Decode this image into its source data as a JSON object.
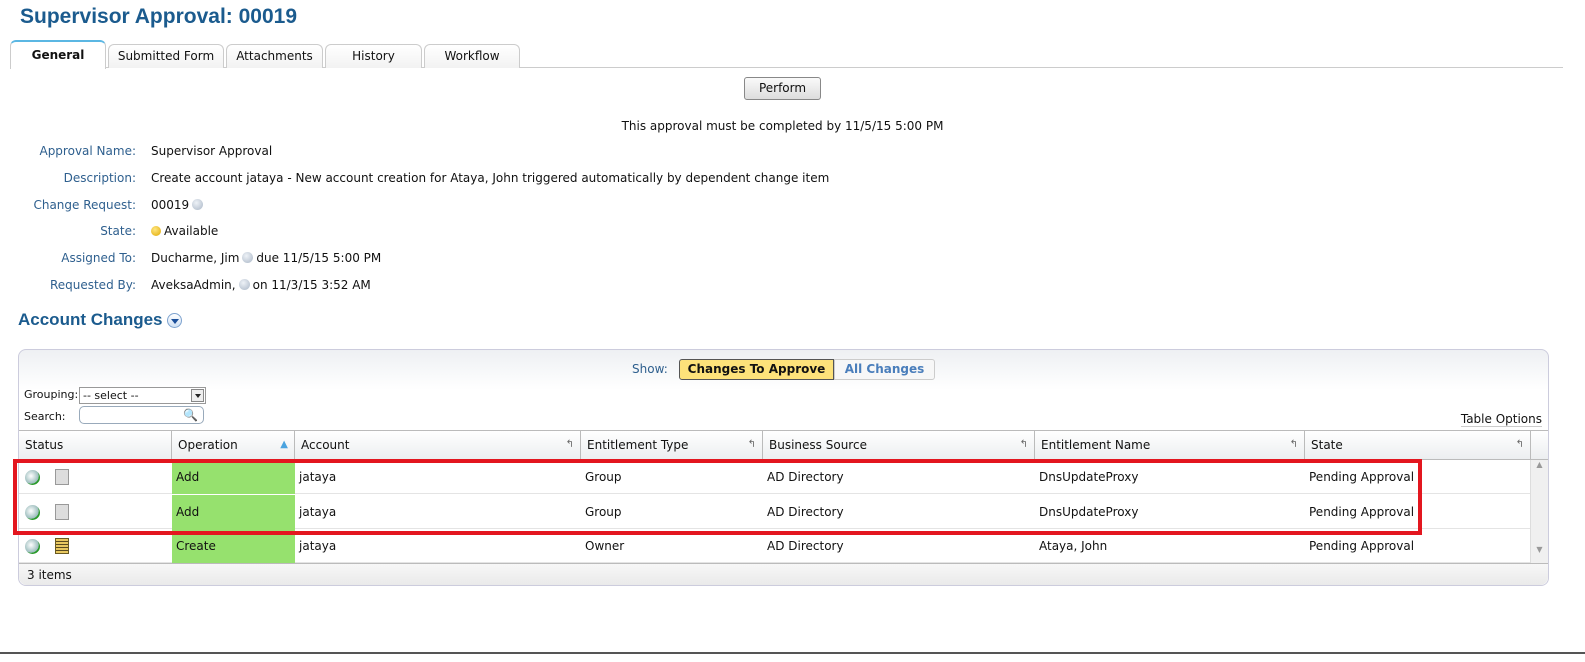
{
  "title": "Supervisor Approval: 00019",
  "tabs": [
    {
      "label": "General",
      "active": true
    },
    {
      "label": "Submitted Form"
    },
    {
      "label": "Attachments"
    },
    {
      "label": "History"
    },
    {
      "label": "Workflow"
    }
  ],
  "perform_label": "Perform",
  "notice": "This approval must be completed by 11/5/15 5:00 PM",
  "fields": {
    "approval_name": {
      "label": "Approval Name:",
      "value": "Supervisor Approval"
    },
    "description": {
      "label": "Description:",
      "value": "Create account jataya - New account creation for Ataya, John triggered automatically by dependent change item"
    },
    "change_request": {
      "label": "Change Request:",
      "value": "00019"
    },
    "state": {
      "label": "State:",
      "value": "Available"
    },
    "assigned_to": {
      "label": "Assigned To:",
      "value": "Ducharme, Jim",
      "suffix": "due 11/5/15 5:00 PM"
    },
    "requested_by": {
      "label": "Requested By:",
      "value": "AveksaAdmin,",
      "suffix": "on 11/3/15 3:52 AM"
    }
  },
  "section_title": "Account Changes",
  "show": {
    "label": "Show:",
    "options": [
      "Changes To Approve",
      "All Changes"
    ],
    "selected": "Changes To Approve"
  },
  "grouping": {
    "label": "Grouping:",
    "value": "-- select --"
  },
  "search": {
    "label": "Search:",
    "value": ""
  },
  "table_options": "Table Options",
  "columns": [
    "Status",
    "Operation",
    "Account",
    "Entitlement Type",
    "Business Source",
    "Entitlement Name",
    "State"
  ],
  "rows": [
    {
      "operation": "Add",
      "account": "jataya",
      "type": "Group",
      "source": "AD Directory",
      "name": "DnsUpdateProxy",
      "state": "Pending Approval",
      "icon": "entitlement-icon"
    },
    {
      "operation": "Add",
      "account": "jataya",
      "type": "Group",
      "source": "AD Directory",
      "name": "DnsUpdateProxy",
      "state": "Pending Approval",
      "icon": "entitlement-icon"
    },
    {
      "operation": "Create",
      "account": "jataya",
      "type": "Owner",
      "source": "AD Directory",
      "name": "Ataya, John",
      "state": "Pending Approval",
      "icon": "account-icon"
    }
  ],
  "footer": "3 items",
  "colors": {
    "title": "#1b5b8e",
    "operation_bg": "#96e16e",
    "highlight": "#e3161f",
    "selected_toggle": "#fde27a"
  }
}
